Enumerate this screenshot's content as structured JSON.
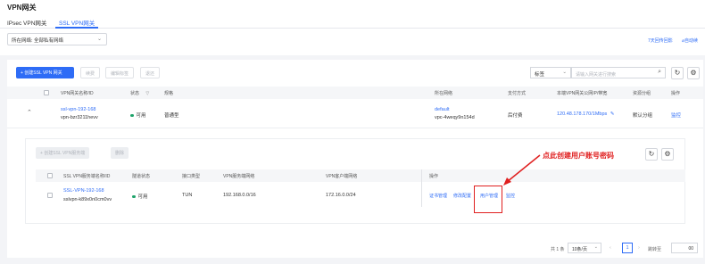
{
  "page": {
    "title": "VPN网关"
  },
  "tabs": [
    {
      "label": "IPsec VPN网关"
    },
    {
      "label": "SSL VPN网关"
    }
  ],
  "filter": {
    "network_value": "所在网络: 全部私有网络"
  },
  "top_links": {
    "free_trial": "7天回传回影",
    "auto_renew": "自动续"
  },
  "toolbar": {
    "create": "+ 创建SSL VPN 网关",
    "renew": "续费",
    "edit_tags": "编辑标签",
    "return": "退还",
    "tag_select": "标签",
    "search_placeholder": "请输入网关进行搜索"
  },
  "table": {
    "headers": [
      "VPN网关名称/ID",
      "状态",
      "规格",
      "所在网络",
      "支付方式",
      "本端VPN网关公网IP/带宽",
      "资源分组",
      "操作"
    ],
    "row": {
      "name": "ssl-vpn-192-168",
      "id": "vpn-bzr3211hevv",
      "status": "可用",
      "spec": "普通型",
      "network_name": "default",
      "network_id": "vpc-4weqy9n154d",
      "payment": "后付费",
      "ip_bw": "120.48.178.170/1Mbps",
      "group": "默认分组",
      "action": "监控"
    }
  },
  "inner": {
    "create": "+ 创建SSL VPN服务端",
    "delete": "删除",
    "headers": [
      "SSL VPN服务端名称/ID",
      "隧道状态",
      "接口类型",
      "VPN服务端网络",
      "VPN客户端网络",
      "操作"
    ],
    "row": {
      "name": "SSL-VPN-192-168",
      "id": "sslvpn-k89x0n0cm0vv",
      "status": "可用",
      "interface": "TUN",
      "server_net": "192.168.0.0/16",
      "client_net": "172.16.0.0/24",
      "actions": [
        "证书管理",
        "修改配置",
        "用户管理",
        "监控"
      ]
    }
  },
  "annotation": {
    "text": "点此创建用户账号密码",
    "color": "#e02020"
  },
  "pagination": {
    "total": "共 1 条",
    "page_size": "10条/页",
    "current_page": "1",
    "jump_label": "跳转至",
    "jump_value": "00"
  },
  "colors": {
    "accent": "#2e6cf6",
    "success": "#1ea36a",
    "annotation": "#e02020"
  }
}
